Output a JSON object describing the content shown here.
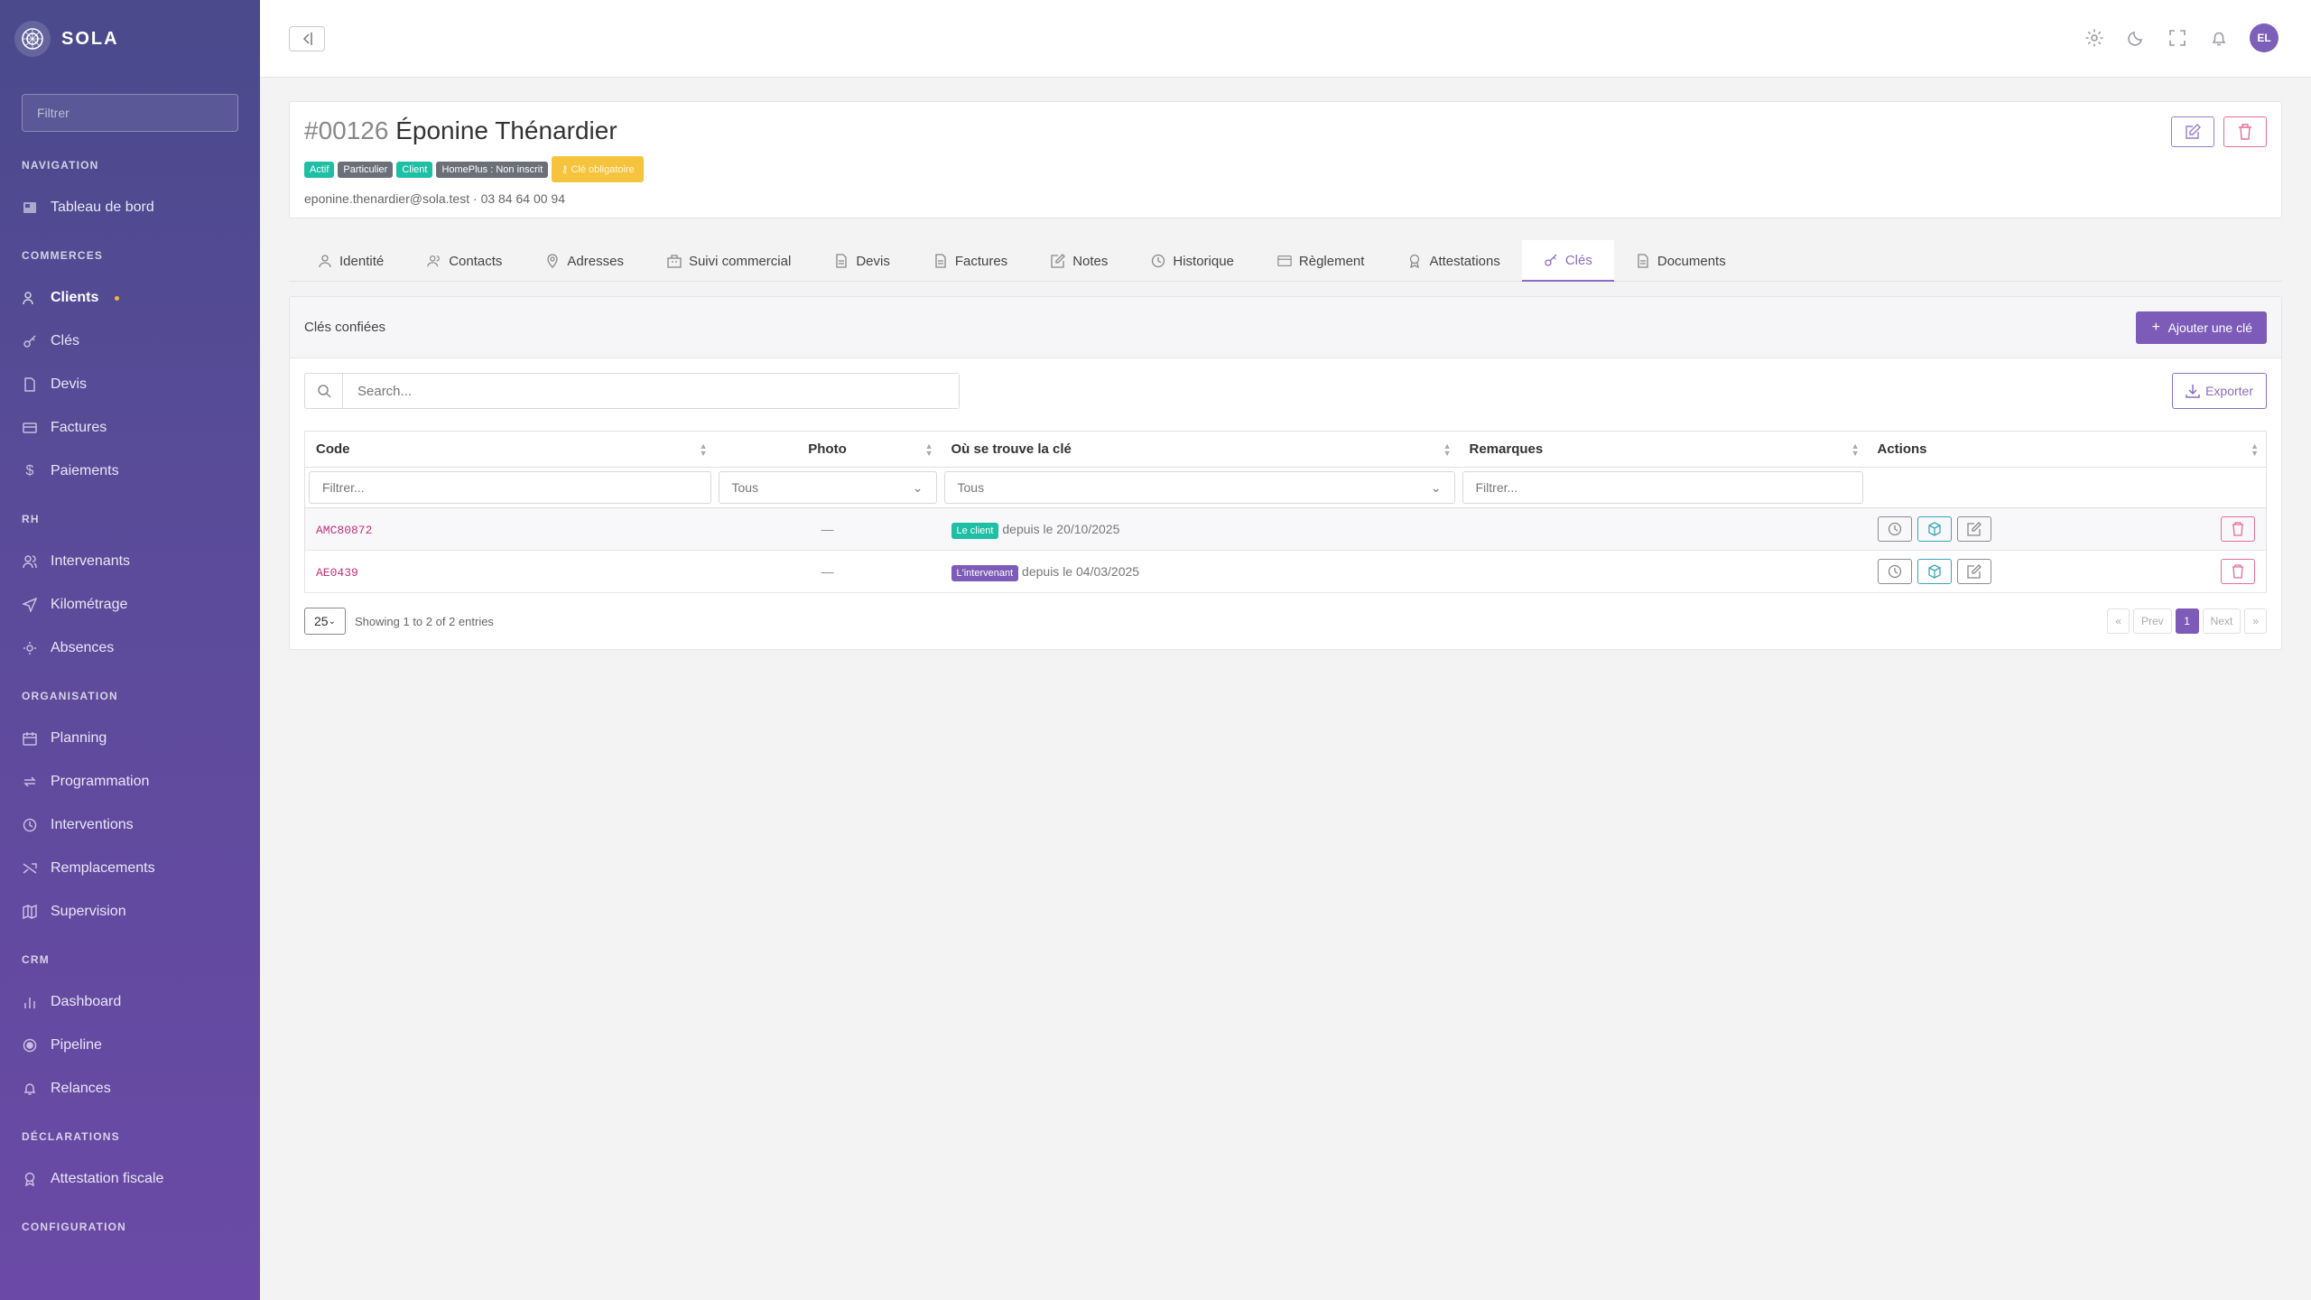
{
  "brand": {
    "name": "SOLA"
  },
  "sidebar": {
    "filter_placeholder": "Filtrer",
    "sections": [
      {
        "title": "NAVIGATION",
        "items": [
          {
            "label": "Tableau de bord",
            "icon": "dashboard-icon"
          }
        ]
      },
      {
        "title": "COMMERCES",
        "items": [
          {
            "label": "Clients",
            "icon": "users-icon",
            "active": true
          },
          {
            "label": "Clés",
            "icon": "key-icon"
          },
          {
            "label": "Devis",
            "icon": "document-icon"
          },
          {
            "label": "Factures",
            "icon": "invoice-icon"
          },
          {
            "label": "Paiements",
            "icon": "dollar-icon"
          }
        ]
      },
      {
        "title": "RH",
        "items": [
          {
            "label": "Intervenants",
            "icon": "people-icon"
          },
          {
            "label": "Kilométrage",
            "icon": "send-icon"
          },
          {
            "label": "Absences",
            "icon": "sun-icon"
          }
        ]
      },
      {
        "title": "ORGANISATION",
        "items": [
          {
            "label": "Planning",
            "icon": "calendar-icon"
          },
          {
            "label": "Programmation",
            "icon": "repeat-icon"
          },
          {
            "label": "Interventions",
            "icon": "clock-icon"
          },
          {
            "label": "Remplacements",
            "icon": "shuffle-icon"
          },
          {
            "label": "Supervision",
            "icon": "map-icon"
          }
        ]
      },
      {
        "title": "CRM",
        "items": [
          {
            "label": "Dashboard",
            "icon": "bar-chart-icon"
          },
          {
            "label": "Pipeline",
            "icon": "target-icon"
          },
          {
            "label": "Relances",
            "icon": "bell-icon"
          }
        ]
      },
      {
        "title": "DÉCLARATIONS",
        "items": [
          {
            "label": "Attestation fiscale",
            "icon": "award-icon"
          }
        ]
      },
      {
        "title": "CONFIGURATION",
        "items": []
      }
    ]
  },
  "topbar": {
    "avatar_initials": "EL"
  },
  "client": {
    "number": "#00126",
    "name": "Éponine Thénardier",
    "badges": [
      {
        "label": "Actif",
        "color": "#1fbfa5"
      },
      {
        "label": "Particulier",
        "color": "#6b6f78"
      },
      {
        "label": "Client",
        "color": "#1fbfa5"
      },
      {
        "label": "HomePlus : Non inscrit",
        "color": "#6b6f78"
      }
    ],
    "warning_badge": "Clé obligatoire",
    "email": "eponine.thenardier@sola.test",
    "phone": "03 84 64 00 94"
  },
  "tabs": [
    {
      "label": "Identité",
      "icon": "user-icon"
    },
    {
      "label": "Contacts",
      "icon": "users-icon"
    },
    {
      "label": "Adresses",
      "icon": "map-pin-icon"
    },
    {
      "label": "Suivi commercial",
      "icon": "building-icon"
    },
    {
      "label": "Devis",
      "icon": "document-icon"
    },
    {
      "label": "Factures",
      "icon": "document-icon"
    },
    {
      "label": "Notes",
      "icon": "edit-icon"
    },
    {
      "label": "Historique",
      "icon": "clock-icon"
    },
    {
      "label": "Règlement",
      "icon": "credit-card-icon"
    },
    {
      "label": "Attestations",
      "icon": "award-icon"
    },
    {
      "label": "Clés",
      "icon": "key-icon",
      "active": true
    },
    {
      "label": "Documents",
      "icon": "document-icon"
    }
  ],
  "panel": {
    "title": "Clés confiées",
    "add_button": "Ajouter une clé",
    "search_placeholder": "Search...",
    "export_button": "Exporter"
  },
  "table": {
    "columns": [
      "Code",
      "Photo",
      "Où se trouve la clé",
      "Remarques",
      "Actions"
    ],
    "filters": {
      "code": "Filtrer...",
      "photo": "Tous",
      "location": "Tous",
      "remarks": "Filtrer..."
    },
    "rows": [
      {
        "code": "AMC80872",
        "photo": "—",
        "location_badge": "Le client",
        "location_color": "#1fbfa5",
        "since": "depuis le 20/10/2025"
      },
      {
        "code": "AE0439",
        "photo": "—",
        "location_badge": "L'intervenant",
        "location_color": "#7d5bb8",
        "since": "depuis le 04/03/2025"
      }
    ]
  },
  "footer": {
    "page_size": "25",
    "info": "Showing 1 to 2 of 2 entries",
    "first": "«",
    "prev": "Prev",
    "current": "1",
    "next": "Next",
    "last": "»"
  }
}
